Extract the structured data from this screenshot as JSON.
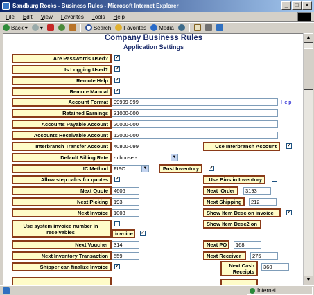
{
  "window": {
    "title": "Sandburg Rocks - Business Rules - Microsoft Internet Explorer"
  },
  "menu": [
    "File",
    "Edit",
    "View",
    "Favorites",
    "Tools",
    "Help"
  ],
  "toolbar": {
    "back": "Back",
    "search": "Search",
    "favorites": "Favorites",
    "media": "Media"
  },
  "page": {
    "title": "Company Business Rules",
    "subtitle": "Application Settings",
    "help": "Help"
  },
  "fields": {
    "passwords_used": {
      "label": "Are Passwords Used?",
      "checked": true
    },
    "logging_used": {
      "label": "Is Logging Used?",
      "checked": true
    },
    "remote_help": {
      "label": "Remote Help",
      "checked": true
    },
    "remote_manual": {
      "label": "Remote Manual",
      "checked": true
    },
    "account_format": {
      "label": "Account Format",
      "value": "99999-999"
    },
    "retained_earnings": {
      "label": "Retained Earnings",
      "value": "31000-000"
    },
    "accounts_payable": {
      "label": "Accounts Payable Account",
      "value": "20000-000"
    },
    "accounts_receivable": {
      "label": "Accounts Receivable Account",
      "value": "12000-000"
    },
    "interbranch_transfer": {
      "label": "Interbranch Transfer Account",
      "value": "40800-099"
    },
    "use_interbranch": {
      "label": "Use Interbranch Account",
      "checked": true
    },
    "default_billing_rate": {
      "label": "Default Billing Rate",
      "value": "- choose -"
    },
    "ic_method": {
      "label": "IC Method",
      "value": "FIFO"
    },
    "post_inventory": {
      "label": "Post Inventory",
      "checked": true
    },
    "allow_step_calcs": {
      "label": "Allow step calcs for quotes",
      "checked": true
    },
    "use_bins": {
      "label": "Use Bins in Inventory",
      "checked": false
    },
    "next_quote": {
      "label": "Next Quote",
      "value": "4606"
    },
    "next_order": {
      "label": "Next_Order",
      "value": "3193"
    },
    "next_picking": {
      "label": "Next Picking",
      "value": "193"
    },
    "next_shipping": {
      "label": "Next Shipping",
      "value": "212"
    },
    "next_invoice": {
      "label": "Next Invoice",
      "value": "1003"
    },
    "show_item_desc_invoice": {
      "label": "Show Item Desc on invoice",
      "checked": true
    },
    "system_invoice_number": {
      "label": "Use system invoice number in receivables",
      "checked": false
    },
    "show_item_desc2": {
      "label": "Show Item Desc2 on",
      "label2": "invoice",
      "checked": true
    },
    "next_voucher": {
      "label": "Next Voucher",
      "value": "314"
    },
    "next_po": {
      "label": "Next PO",
      "value": "168"
    },
    "next_inventory_transaction": {
      "label": "Next Inventory Transaction",
      "value": "559"
    },
    "next_receiver": {
      "label": "Next Receiver",
      "value": "275"
    },
    "shipper_finalize": {
      "label": "Shipper can finalize Invoice",
      "checked": true
    },
    "next_cash_receipts": {
      "label": "Next Cash Receipts",
      "value": "360"
    }
  },
  "status": {
    "zone": "Internet"
  }
}
